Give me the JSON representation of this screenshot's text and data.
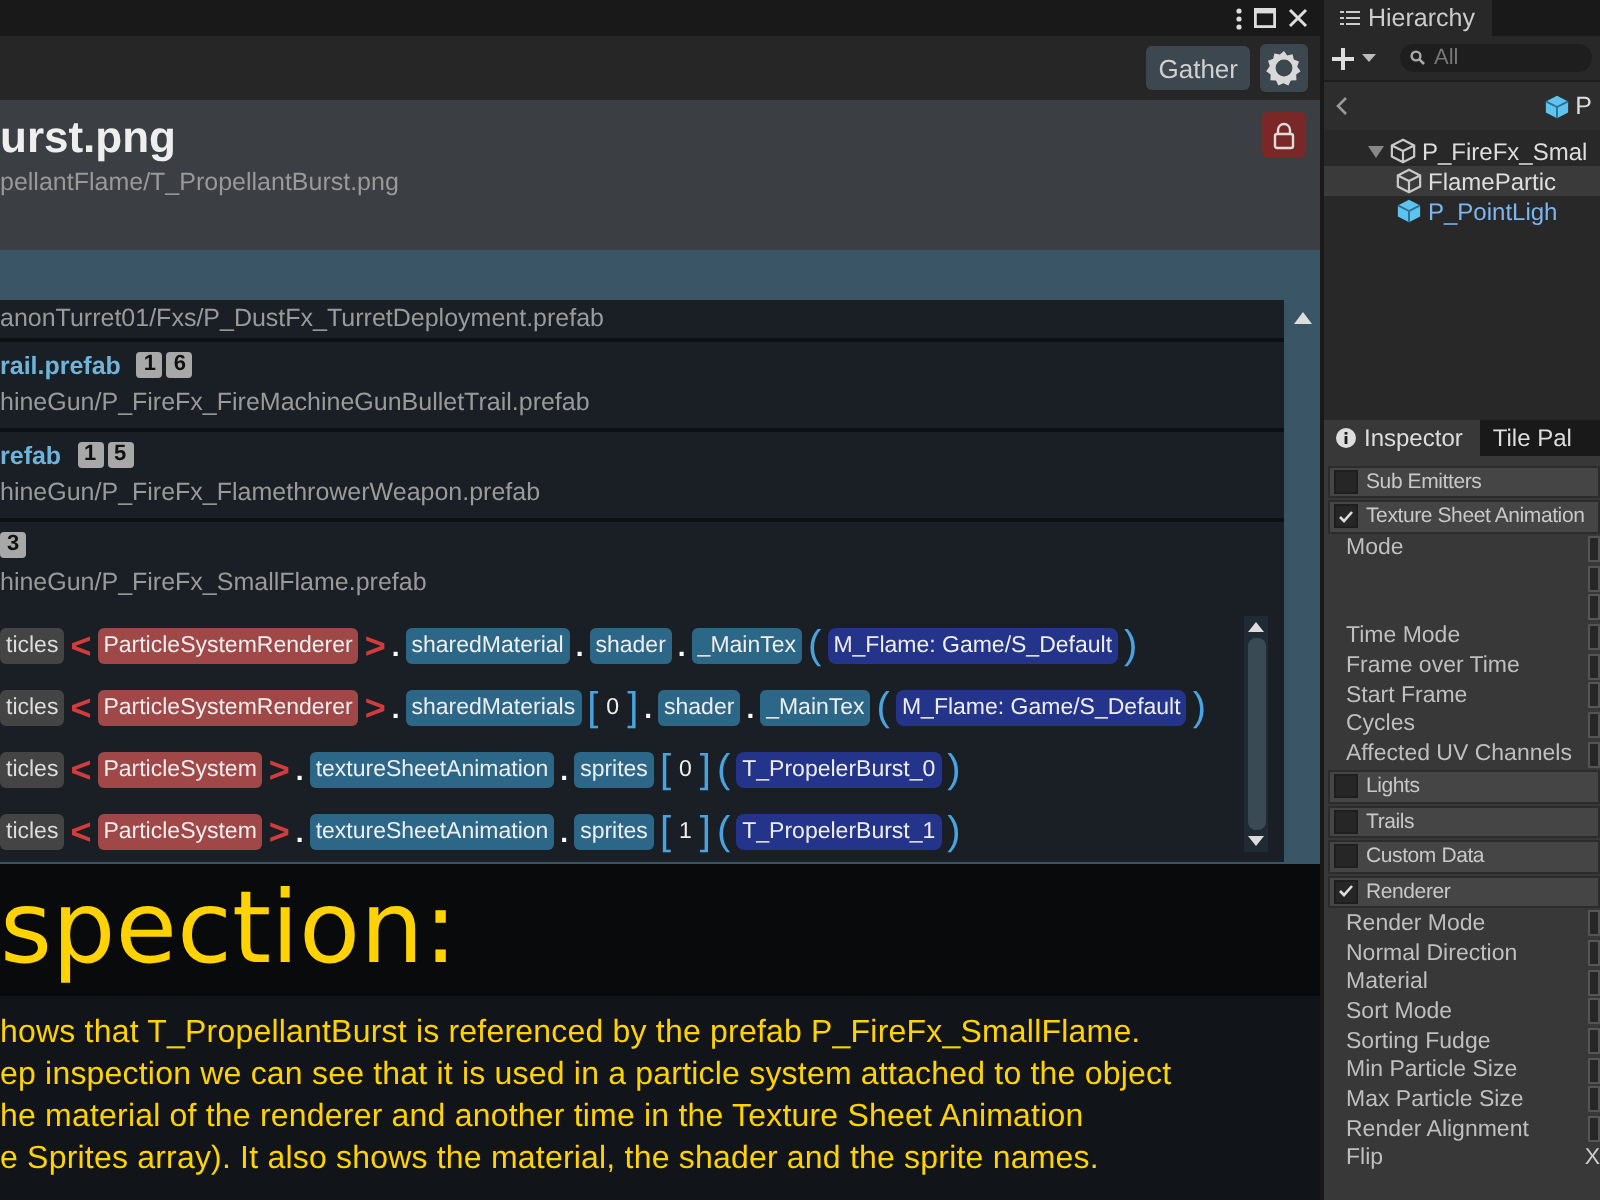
{
  "toolbar": {
    "gather_button": "Gather"
  },
  "asset": {
    "title": "urst.png",
    "path": "pellantFlame/T_PropellantBurst.png"
  },
  "results": [
    {
      "path": "anonTurret01/Fxs/P_DustFx_TurretDeployment.prefab"
    },
    {
      "name": "rail.prefab",
      "counts": [
        "1",
        "6"
      ],
      "path": "hineGun/P_FireFx_FireMachineGunBulletTrail.prefab"
    },
    {
      "name": "refab",
      "counts": [
        "1",
        "5"
      ],
      "path": "hineGun/P_FireFx_FlamethrowerWeapon.prefab"
    },
    {
      "counts": [
        "3"
      ],
      "path": "hineGun/P_FireFx_SmallFlame.prefab",
      "chains": [
        [
          {
            "kind": "object",
            "text": "ticles"
          },
          {
            "kind": "angle",
            "text": "<"
          },
          {
            "kind": "component",
            "text": "ParticleSystemRenderer"
          },
          {
            "kind": "angle",
            "text": ">"
          },
          {
            "kind": "dot",
            "text": "."
          },
          {
            "kind": "member",
            "text": "sharedMaterial"
          },
          {
            "kind": "dot",
            "text": "."
          },
          {
            "kind": "member",
            "text": "shader"
          },
          {
            "kind": "dot",
            "text": "."
          },
          {
            "kind": "member",
            "text": "_MainTex"
          },
          {
            "kind": "paren",
            "text": "("
          },
          {
            "kind": "value",
            "text": "M_Flame: Game/S_Default"
          },
          {
            "kind": "paren",
            "text": ")"
          }
        ],
        [
          {
            "kind": "object",
            "text": "ticles"
          },
          {
            "kind": "angle",
            "text": "<"
          },
          {
            "kind": "component",
            "text": "ParticleSystemRenderer"
          },
          {
            "kind": "angle",
            "text": ">"
          },
          {
            "kind": "dot",
            "text": "."
          },
          {
            "kind": "member",
            "text": "sharedMaterials"
          },
          {
            "kind": "bracket",
            "text": "["
          },
          {
            "kind": "index",
            "text": "0"
          },
          {
            "kind": "bracket",
            "text": "]"
          },
          {
            "kind": "dot",
            "text": "."
          },
          {
            "kind": "member",
            "text": "shader"
          },
          {
            "kind": "dot",
            "text": "."
          },
          {
            "kind": "member",
            "text": "_MainTex"
          },
          {
            "kind": "paren",
            "text": "("
          },
          {
            "kind": "value",
            "text": "M_Flame: Game/S_Default"
          },
          {
            "kind": "paren",
            "text": ")"
          }
        ],
        [
          {
            "kind": "object",
            "text": "ticles"
          },
          {
            "kind": "angle",
            "text": "<"
          },
          {
            "kind": "component",
            "text": "ParticleSystem"
          },
          {
            "kind": "angle",
            "text": ">"
          },
          {
            "kind": "dot",
            "text": "."
          },
          {
            "kind": "member",
            "text": "textureSheetAnimation"
          },
          {
            "kind": "dot",
            "text": "."
          },
          {
            "kind": "member",
            "text": "sprites"
          },
          {
            "kind": "bracket",
            "text": "["
          },
          {
            "kind": "index",
            "text": "0"
          },
          {
            "kind": "bracket",
            "text": "]"
          },
          {
            "kind": "paren",
            "text": "("
          },
          {
            "kind": "value",
            "text": "T_PropelerBurst_0"
          },
          {
            "kind": "paren",
            "text": ")"
          }
        ],
        [
          {
            "kind": "object",
            "text": "ticles"
          },
          {
            "kind": "angle",
            "text": "<"
          },
          {
            "kind": "component",
            "text": "ParticleSystem"
          },
          {
            "kind": "angle",
            "text": ">"
          },
          {
            "kind": "dot",
            "text": "."
          },
          {
            "kind": "member",
            "text": "textureSheetAnimation"
          },
          {
            "kind": "dot",
            "text": "."
          },
          {
            "kind": "member",
            "text": "sprites"
          },
          {
            "kind": "bracket",
            "text": "["
          },
          {
            "kind": "index",
            "text": "1"
          },
          {
            "kind": "bracket",
            "text": "]"
          },
          {
            "kind": "paren",
            "text": "("
          },
          {
            "kind": "value",
            "text": "T_PropelerBurst_1"
          },
          {
            "kind": "paren",
            "text": ")"
          }
        ]
      ]
    }
  ],
  "caption": {
    "heading": "spection:",
    "lines": [
      "hows that T_PropellantBurst is referenced by the prefab P_FireFx_SmallFlame.",
      "ep inspection we can see that it is used in a particle system attached to the object",
      "he material of the renderer and another time in the Texture Sheet Animation",
      "e Sprites array). It also shows the material, the shader and the sprite names."
    ]
  },
  "hierarchy": {
    "tab": "Hierarchy",
    "search": {
      "placeholder": "All"
    },
    "breadcrumb": "P",
    "tree": [
      {
        "label": "P_FireFx_Smal",
        "kind": "object",
        "expanded": true,
        "selected": false,
        "children": [
          {
            "label": "FlamePartic",
            "kind": "object",
            "selected": true
          },
          {
            "label": "P_PointLigh",
            "kind": "prefab",
            "selected": false
          }
        ]
      }
    ]
  },
  "inspector": {
    "tabs": [
      {
        "label": "Inspector",
        "selected": true
      },
      {
        "label": "Tile Pal",
        "selected": false
      }
    ],
    "rows": [
      {
        "kind": "module",
        "label": "Sub Emitters",
        "checked": false
      },
      {
        "kind": "module",
        "label": "Texture Sheet Animation",
        "checked": true
      },
      {
        "kind": "property",
        "label": "Mode"
      },
      {
        "kind": "field"
      },
      {
        "kind": "field"
      },
      {
        "kind": "property",
        "label": "Time Mode"
      },
      {
        "kind": "property",
        "label": "Frame over Time"
      },
      {
        "kind": "property",
        "label": "Start Frame"
      },
      {
        "kind": "property",
        "label": "Cycles"
      },
      {
        "kind": "property",
        "label": "Affected UV Channels"
      },
      {
        "kind": "module",
        "label": "Lights",
        "checked": false
      },
      {
        "kind": "module",
        "label": "Trails",
        "checked": false
      },
      {
        "kind": "module",
        "label": "Custom Data",
        "checked": false
      },
      {
        "kind": "module",
        "label": "Renderer",
        "checked": true
      },
      {
        "kind": "property",
        "label": "Render Mode"
      },
      {
        "kind": "property",
        "label": "Normal Direction"
      },
      {
        "kind": "property",
        "label": "Material"
      },
      {
        "kind": "property",
        "label": "Sort Mode"
      },
      {
        "kind": "property",
        "label": "Sorting Fudge"
      },
      {
        "kind": "property",
        "label": "Min Particle Size"
      },
      {
        "kind": "property",
        "label": "Max Particle Size"
      },
      {
        "kind": "property",
        "label": "Render Alignment"
      },
      {
        "kind": "property",
        "label": "Flip",
        "value": "X"
      }
    ]
  }
}
